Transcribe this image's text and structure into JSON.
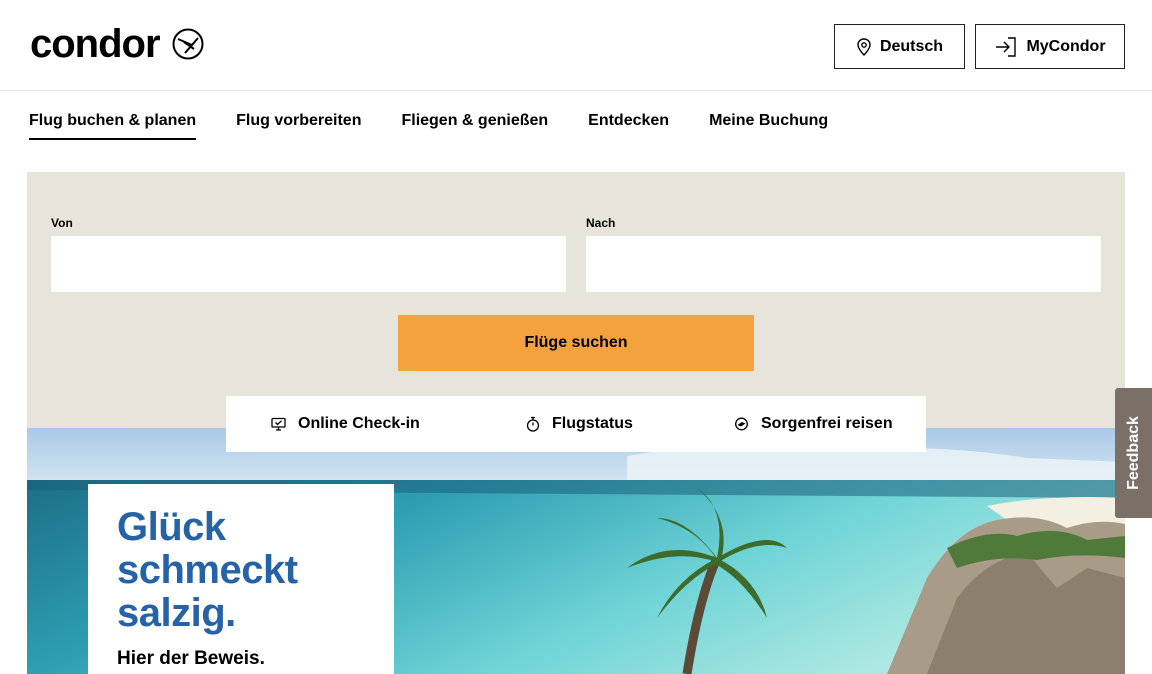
{
  "header": {
    "logo_text": "condor",
    "language_button": "Deutsch",
    "account_button": "MyCondor"
  },
  "nav": {
    "items": [
      {
        "label": "Flug buchen & planen",
        "active": true
      },
      {
        "label": "Flug vorbereiten",
        "active": false
      },
      {
        "label": "Fliegen & genießen",
        "active": false
      },
      {
        "label": "Entdecken",
        "active": false
      },
      {
        "label": "Meine Buchung",
        "active": false
      }
    ]
  },
  "search": {
    "from_label": "Von",
    "from_value": "",
    "to_label": "Nach",
    "to_value": "",
    "submit_label": "Flüge suchen"
  },
  "quick_links": [
    {
      "label": "Online Check-in",
      "icon": "checkin-monitor-icon"
    },
    {
      "label": "Flugstatus",
      "icon": "stopwatch-icon"
    },
    {
      "label": "Sorgenfrei reisen",
      "icon": "shield-plane-icon"
    }
  ],
  "hero": {
    "headline_line1": "Glück",
    "headline_line2": "schmeckt",
    "headline_line3": "salzig.",
    "subline1": "Hier der Beweis."
  },
  "feedback_label": "Feedback",
  "colors": {
    "accent": "#f4a23e",
    "panel_bg": "#e7e4dc",
    "headline_blue": "#2563a6",
    "feedback_bg": "#7a7068"
  }
}
